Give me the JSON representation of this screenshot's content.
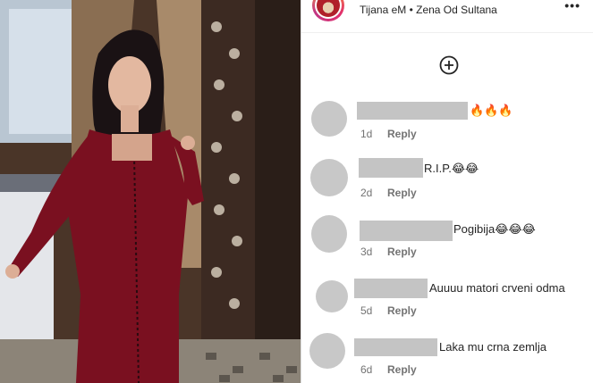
{
  "post": {
    "audio_info": "Tijana eM • Zena Od Sultana"
  },
  "icons": {
    "more": "more-options-icon",
    "load_more": "plus-circle-icon"
  },
  "colors": {
    "dress": "#7a1020",
    "avatar_placeholder": "#c8c8c8",
    "redaction": "#c4c4c4",
    "meta_text": "#737373"
  },
  "comments": [
    {
      "text": "🔥🔥🔥",
      "time": "1d",
      "reply": "Reply"
    },
    {
      "text": "R.I.P.😂😂",
      "time": "2d",
      "reply": "Reply"
    },
    {
      "text": "Pogibija😂😂😂",
      "time": "3d",
      "reply": "Reply"
    },
    {
      "text": "Auuuu matori crveni odma",
      "time": "5d",
      "reply": "Reply"
    },
    {
      "text": "Laka mu crna zemlja",
      "time": "6d",
      "reply": "Reply"
    }
  ]
}
